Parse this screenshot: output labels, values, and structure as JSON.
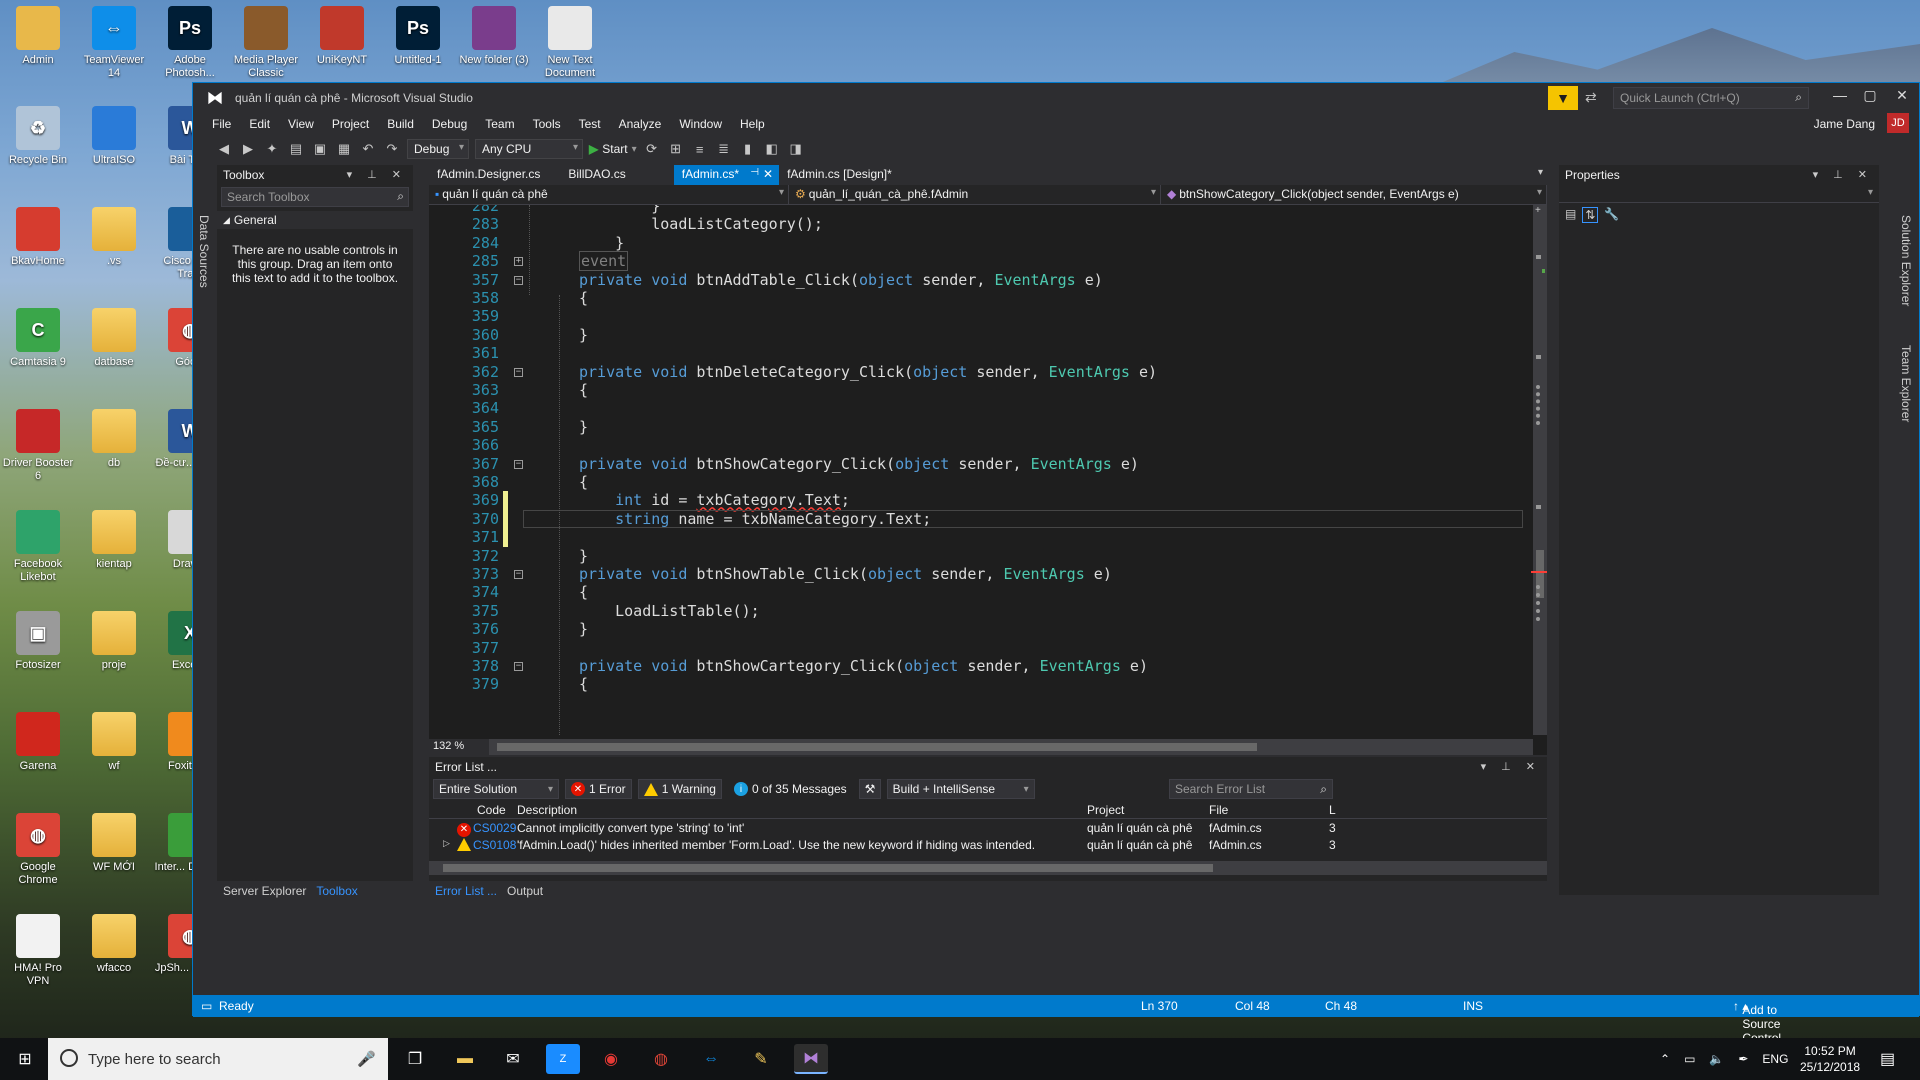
{
  "desktop": {
    "icons": [
      {
        "label": "Admin",
        "icon": "user-folder-icon",
        "color": "#e8b84a"
      },
      {
        "label": "TeamViewer 14",
        "icon": "teamviewer-icon",
        "color": "#0e8ee9"
      },
      {
        "label": "Adobe Photosh...",
        "icon": "photoshop-icon",
        "color": "#001e36"
      },
      {
        "label": "Media Player Classic",
        "icon": "media-player-icon",
        "color": "#8a5a2b"
      },
      {
        "label": "UniKeyNT",
        "icon": "unikey-icon",
        "color": "#c0392b"
      },
      {
        "label": "Untitled-1",
        "icon": "psd-file-icon",
        "color": "#001e36"
      },
      {
        "label": "New folder (3)",
        "icon": "winrar-icon",
        "color": "#7a3d8c"
      },
      {
        "label": "New Text Document",
        "icon": "text-file-icon",
        "color": "#e9e9e9"
      },
      {
        "label": "Recycle Bin",
        "icon": "recycle-bin-icon",
        "color": "#b0c4d8"
      },
      {
        "label": "UltraISO",
        "icon": "ultraiso-icon",
        "color": "#2a7bd8"
      },
      {
        "label": "Bài Th...",
        "icon": "word-icon",
        "color": "#2b579a"
      },
      {
        "label": "BkavHome",
        "icon": "bkav-icon",
        "color": "#d63c2f"
      },
      {
        "label": ".vs",
        "icon": "folder-icon",
        "color": "#f0c75a"
      },
      {
        "label": "Cisco Pa... Tra...",
        "icon": "cisco-icon",
        "color": "#1a5e9a"
      },
      {
        "label": "Camtasia 9",
        "icon": "camtasia-icon",
        "color": "#3aa64a"
      },
      {
        "label": "datbase",
        "icon": "folder-icon",
        "color": "#f0c75a"
      },
      {
        "label": "Góc...",
        "icon": "chrome-icon",
        "color": "#db4437"
      },
      {
        "label": "Driver Booster 6",
        "icon": "driver-booster-icon",
        "color": "#c62828"
      },
      {
        "label": "db",
        "icon": "folder-icon",
        "color": "#f0c75a"
      },
      {
        "label": "Đề-cư... Quốc",
        "icon": "word-icon",
        "color": "#2b579a"
      },
      {
        "label": "Facebook Likebot",
        "icon": "likebot-icon",
        "color": "#2ea36a"
      },
      {
        "label": "kientap",
        "icon": "folder-icon",
        "color": "#f0c75a"
      },
      {
        "label": "Draw...",
        "icon": "draw-icon",
        "color": "#d8d8d8"
      },
      {
        "label": "Fotosizer",
        "icon": "camera-icon",
        "color": "#9a9a9a"
      },
      {
        "label": "proje",
        "icon": "folder-icon",
        "color": "#f0c75a"
      },
      {
        "label": "Excel...",
        "icon": "excel-icon",
        "color": "#217346"
      },
      {
        "label": "Garena",
        "icon": "garena-icon",
        "color": "#d0271d"
      },
      {
        "label": "wf",
        "icon": "folder-icon",
        "color": "#f0c75a"
      },
      {
        "label": "Foxit R...",
        "icon": "foxit-icon",
        "color": "#f08a1d"
      },
      {
        "label": "Google Chrome",
        "icon": "chrome-icon",
        "color": "#db4437"
      },
      {
        "label": "WF MỚI",
        "icon": "folder-icon",
        "color": "#f0c75a"
      },
      {
        "label": "Inter... Down...",
        "icon": "idm-icon",
        "color": "#3a9d3a"
      },
      {
        "label": "HMA! Pro VPN",
        "icon": "hma-icon",
        "color": "#f2f2f2"
      },
      {
        "label": "wfacco",
        "icon": "folder-icon",
        "color": "#f0c75a"
      },
      {
        "label": "JpSh... Chro...",
        "icon": "chrome-icon",
        "color": "#db4437"
      }
    ]
  },
  "window": {
    "title": "quản lí quán cà phê - Microsoft Visual Studio",
    "quick_launch_placeholder": "Quick Launch (Ctrl+Q)",
    "user_name": "Jame Dang",
    "user_initials": "JD",
    "menu": [
      "File",
      "Edit",
      "View",
      "Project",
      "Build",
      "Debug",
      "Team",
      "Tools",
      "Test",
      "Analyze",
      "Window",
      "Help"
    ],
    "toolbar": {
      "config": "Debug",
      "platform": "Any CPU",
      "start_label": "Start"
    }
  },
  "side_strips": {
    "left": "Data Sources",
    "right_top": "Solution Explorer",
    "right_bottom": "Team Explorer"
  },
  "toolbox": {
    "title": "Toolbox",
    "search_placeholder": "Search Toolbox",
    "group": "General",
    "note": "There are no usable controls in this group. Drag an item onto this text to add it to the toolbox.",
    "bottom_tabs": [
      "Server Explorer",
      "Toolbox"
    ]
  },
  "editor": {
    "tabs": [
      "fAdmin.Designer.cs",
      "BillDAO.cs",
      "fAdmin.cs*",
      "fAdmin.cs [Design]*"
    ],
    "nav": [
      "quản lí quán cà phê",
      "quản_lí_quán_cà_phê.fAdmin",
      "btnShowCategory_Click(object sender, EventArgs e)"
    ],
    "zoom": "132 %",
    "lines": [
      {
        "n": "282",
        "t": "        }"
      },
      {
        "n": "283",
        "t": "        loadListCategory();"
      },
      {
        "n": "284",
        "t": "    }"
      },
      {
        "n": "285",
        "t": "event"
      },
      {
        "n": "357",
        "t": "private void btnAddTable_Click(object sender, EventArgs e)"
      },
      {
        "n": "358",
        "t": "{"
      },
      {
        "n": "359",
        "t": ""
      },
      {
        "n": "360",
        "t": "}"
      },
      {
        "n": "361",
        "t": ""
      },
      {
        "n": "362",
        "t": "private void btnDeleteCategory_Click(object sender, EventArgs e)"
      },
      {
        "n": "363",
        "t": "{"
      },
      {
        "n": "364",
        "t": ""
      },
      {
        "n": "365",
        "t": "}"
      },
      {
        "n": "366",
        "t": ""
      },
      {
        "n": "367",
        "t": "private void btnShowCategory_Click(object sender, EventArgs e)"
      },
      {
        "n": "368",
        "t": "{"
      },
      {
        "n": "369",
        "t": "int id = txbCategory.Text;"
      },
      {
        "n": "370",
        "t": "string name = txbNameCategory.Text;"
      },
      {
        "n": "371",
        "t": ""
      },
      {
        "n": "372",
        "t": "}"
      },
      {
        "n": "373",
        "t": "private void btnShowTable_Click(object sender, EventArgs e)"
      },
      {
        "n": "374",
        "t": "{"
      },
      {
        "n": "375",
        "t": "LoadListTable();"
      },
      {
        "n": "376",
        "t": "}"
      },
      {
        "n": "377",
        "t": ""
      },
      {
        "n": "378",
        "t": "private void btnShowCartegory_Click(object sender, EventArgs e)"
      },
      {
        "n": "379",
        "t": "{"
      }
    ]
  },
  "error_list": {
    "title": "Error List ...",
    "scope": "Entire Solution",
    "errors_label": "1 Error",
    "warnings_label": "1 Warning",
    "messages_label": "0 of 35 Messages",
    "build_filter": "Build + IntelliSense",
    "search_placeholder": "Search Error List",
    "columns": [
      "Code",
      "Description",
      "Project",
      "File",
      "L"
    ],
    "rows": [
      {
        "severity": "error",
        "code": "CS0029",
        "description": "Cannot implicitly convert type 'string' to 'int'",
        "project": "quản lí quán cà phê",
        "file": "fAdmin.cs",
        "line": "3"
      },
      {
        "severity": "warning",
        "code": "CS0108",
        "description": "'fAdmin.Load()' hides inherited member 'Form.Load'. Use the new keyword if hiding was intended.",
        "project": "quản lí quán cà phê",
        "file": "fAdmin.cs",
        "line": "3"
      }
    ],
    "bottom_tabs": [
      "Error List ...",
      "Output"
    ]
  },
  "properties": {
    "title": "Properties"
  },
  "status": {
    "ready": "Ready",
    "ln": "Ln 370",
    "col": "Col 48",
    "ch": "Ch 48",
    "ins": "INS",
    "source_control": "Add to Source Control"
  },
  "taskbar": {
    "search_placeholder": "Type here to search",
    "lang": "ENG",
    "time": "10:52 PM",
    "date": "25/12/2018"
  },
  "colors": {
    "accent": "#007acc",
    "error": "#e51400",
    "warning": "#ffcc00",
    "keyword": "#569cd6",
    "type": "#4ec9b0",
    "line_number": "#2b91af"
  }
}
